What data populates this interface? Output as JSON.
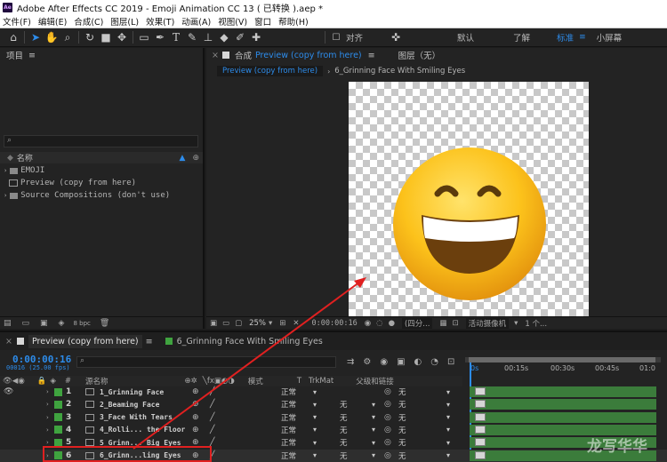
{
  "title_bar": {
    "app_icon": "Ae",
    "title": "Adobe After Effects CC 2019 - Emoji Animation CC 13 ( 已转换 ).aep *"
  },
  "menu": [
    "文件(F)",
    "编辑(E)",
    "合成(C)",
    "图层(L)",
    "效果(T)",
    "动画(A)",
    "视图(V)",
    "窗口",
    "帮助(H)"
  ],
  "toolbar": {
    "tools": [
      "home-icon",
      "selection-arrow-icon",
      "hand-icon",
      "zoom-icon",
      "rotate-icon",
      "camera-icon",
      "pan-behind-icon",
      "rectangle-icon",
      "pen-icon",
      "type-icon",
      "brush-icon",
      "clone-stamp-icon",
      "eraser-icon",
      "roto-brush-icon",
      "puppet-pin-icon"
    ],
    "align_label": "对齐",
    "workspaces": [
      "默认",
      "了解",
      "标准",
      "小屏幕"
    ],
    "active_workspace": "标准"
  },
  "project": {
    "title": "项目",
    "column_name": "名称",
    "items": [
      {
        "icon": "folder-icon",
        "label": "EMOJI"
      },
      {
        "icon": "composition-icon",
        "label": "Preview (copy from here)"
      },
      {
        "icon": "folder-icon",
        "label": "Source Compositions (don't use)"
      }
    ],
    "bpc": "8 bpc"
  },
  "composition_panel": {
    "tab_prefix": "合成",
    "tab_name": "Preview (copy from here)",
    "layer_tab": "图层（无）",
    "breadcrumbs": [
      "Preview (copy from here)",
      "6_Grinning Face With Smiling Eyes"
    ],
    "zoom": "25%",
    "timecode": "0:00:00:16",
    "resolution": "(四分...",
    "camera": "活动摄像机",
    "views": "1 个..."
  },
  "timeline": {
    "tabs": [
      "Preview (copy from here)",
      "6_Grinning Face With Smiling Eyes"
    ],
    "current_time": "0:00:00:16",
    "frame_info": "00016 (25.00 fps)",
    "columns": {
      "number": "#",
      "source_name": "源名称",
      "mode": "模式",
      "t": "T",
      "trkmat": "TrkMat",
      "parent": "父级和链接"
    },
    "ruler": [
      "0s",
      "00:15s",
      "00:30s",
      "00:45s",
      "01:0"
    ],
    "layers": [
      {
        "num": "1",
        "name": "1_Grinning Face",
        "mode": "正常",
        "trkmat": "",
        "parent": "无"
      },
      {
        "num": "2",
        "name": "2_Beaming Face",
        "mode": "正常",
        "trkmat": "无",
        "parent": "无"
      },
      {
        "num": "3",
        "name": "3_Face With Tears",
        "mode": "正常",
        "trkmat": "无",
        "parent": "无"
      },
      {
        "num": "4",
        "name": "4_Rolli... the Floor",
        "mode": "正常",
        "trkmat": "无",
        "parent": "无"
      },
      {
        "num": "5",
        "name": "5_Grinn... Big Eyes",
        "mode": "正常",
        "trkmat": "无",
        "parent": "无"
      },
      {
        "num": "6",
        "name": "6_Grinn...ling Eyes",
        "mode": "正常",
        "trkmat": "无",
        "parent": "无"
      }
    ]
  },
  "watermark": "龙写华华",
  "colors": {
    "accent": "#2d8ceb",
    "highlight_box": "#e02020",
    "label_green": "#3fa33f",
    "bar_green": "#3b7c3b"
  }
}
